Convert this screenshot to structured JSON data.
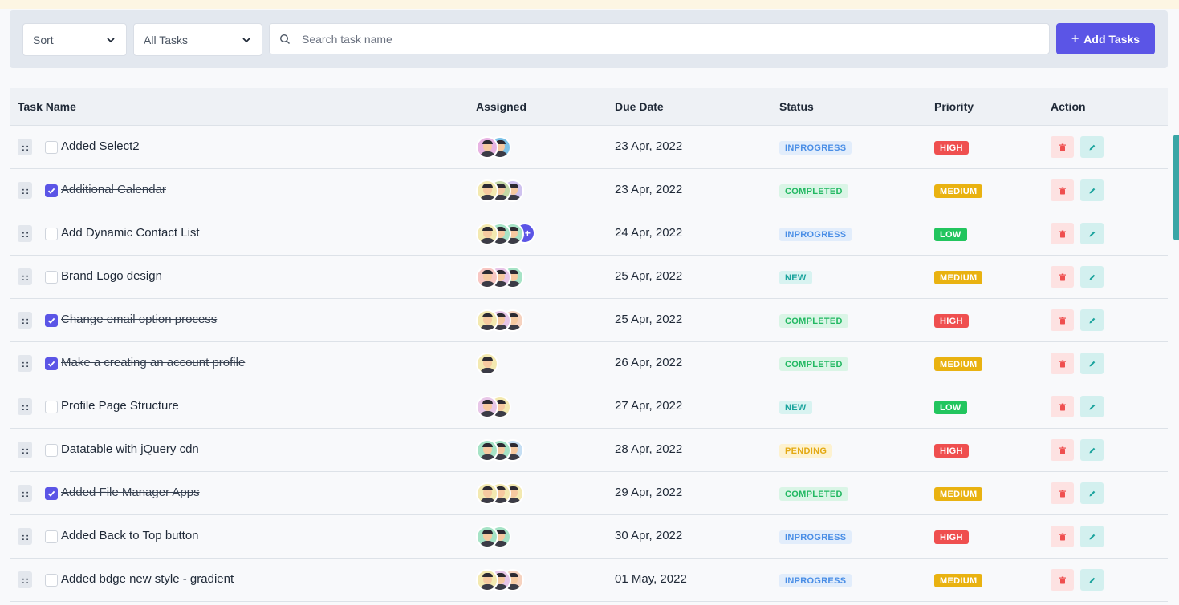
{
  "filters": {
    "sort_label": "Sort",
    "tasks_label": "All Tasks",
    "search_placeholder": "Search task name",
    "add_button": "Add Tasks"
  },
  "columns": {
    "task": "Task Name",
    "assigned": "Assigned",
    "due": "Due Date",
    "status": "Status",
    "priority": "Priority",
    "action": "Action"
  },
  "colors": {
    "accent": "#5b55e6",
    "status": {
      "INPROGRESS": {
        "bg": "#e2edfb",
        "fg": "#4a8ee6"
      },
      "COMPLETED": {
        "bg": "#daf5e6",
        "fg": "#22b862"
      },
      "NEW": {
        "bg": "#d8f3f1",
        "fg": "#1aa39d"
      },
      "PENDING": {
        "bg": "#fdf2d0",
        "fg": "#e3a913"
      }
    },
    "priority": {
      "HIGH": "#ef4f4f",
      "MEDIUM": "#e9b211",
      "LOW": "#22c55e"
    }
  },
  "rows": [
    {
      "task": "Added Select2",
      "done": false,
      "avatars": [
        "#e8b4e3",
        "#7ec3e8"
      ],
      "more": "",
      "due": "23 Apr, 2022",
      "status": "INPROGRESS",
      "priority": "HIGH"
    },
    {
      "task": "Additional Calendar",
      "done": true,
      "avatars": [
        "#f3e9b0",
        "#c5d9a7",
        "#cfc2ef"
      ],
      "more": "",
      "due": "23 Apr, 2022",
      "status": "COMPLETED",
      "priority": "MEDIUM"
    },
    {
      "task": "Add Dynamic Contact List",
      "done": false,
      "avatars": [
        "#f3e9b0",
        "#a6e3c6",
        "#a6e3c6"
      ],
      "more": "1+",
      "due": "24 Apr, 2022",
      "status": "INPROGRESS",
      "priority": "LOW"
    },
    {
      "task": "Brand Logo design",
      "done": false,
      "avatars": [
        "#f8c7c3",
        "#e8c7e8",
        "#a6e3c6"
      ],
      "more": "",
      "due": "25 Apr, 2022",
      "status": "NEW",
      "priority": "MEDIUM"
    },
    {
      "task": "Change email option process",
      "done": true,
      "avatars": [
        "#f3e9b0",
        "#e8c7e8",
        "#f6d2bf"
      ],
      "more": "",
      "due": "25 Apr, 2022",
      "status": "COMPLETED",
      "priority": "HIGH"
    },
    {
      "task": "Make a creating an account profile",
      "done": true,
      "avatars": [
        "#f3e9b0"
      ],
      "more": "",
      "due": "26 Apr, 2022",
      "status": "COMPLETED",
      "priority": "MEDIUM"
    },
    {
      "task": "Profile Page Structure",
      "done": false,
      "avatars": [
        "#e8c7e8",
        "#f3e9b0"
      ],
      "more": "",
      "due": "27 Apr, 2022",
      "status": "NEW",
      "priority": "LOW"
    },
    {
      "task": "Datatable with jQuery cdn",
      "done": false,
      "avatars": [
        "#a6e3c6",
        "#a6e3c6",
        "#c5def3"
      ],
      "more": "",
      "due": "28 Apr, 2022",
      "status": "PENDING",
      "priority": "HIGH"
    },
    {
      "task": "Added File Manager Apps",
      "done": true,
      "avatars": [
        "#f3e9b0",
        "#f3e9b0",
        "#f3e9b0"
      ],
      "more": "",
      "due": "29 Apr, 2022",
      "status": "COMPLETED",
      "priority": "MEDIUM"
    },
    {
      "task": "Added Back to Top button",
      "done": false,
      "avatars": [
        "#a6e3c6",
        "#a6e3c6"
      ],
      "more": "",
      "due": "30 Apr, 2022",
      "status": "INPROGRESS",
      "priority": "HIGH"
    },
    {
      "task": "Added bdge new style - gradient",
      "done": false,
      "avatars": [
        "#f3e9b0",
        "#e8c7e8",
        "#f6d2bf"
      ],
      "more": "",
      "due": "01 May, 2022",
      "status": "INPROGRESS",
      "priority": "MEDIUM"
    }
  ]
}
